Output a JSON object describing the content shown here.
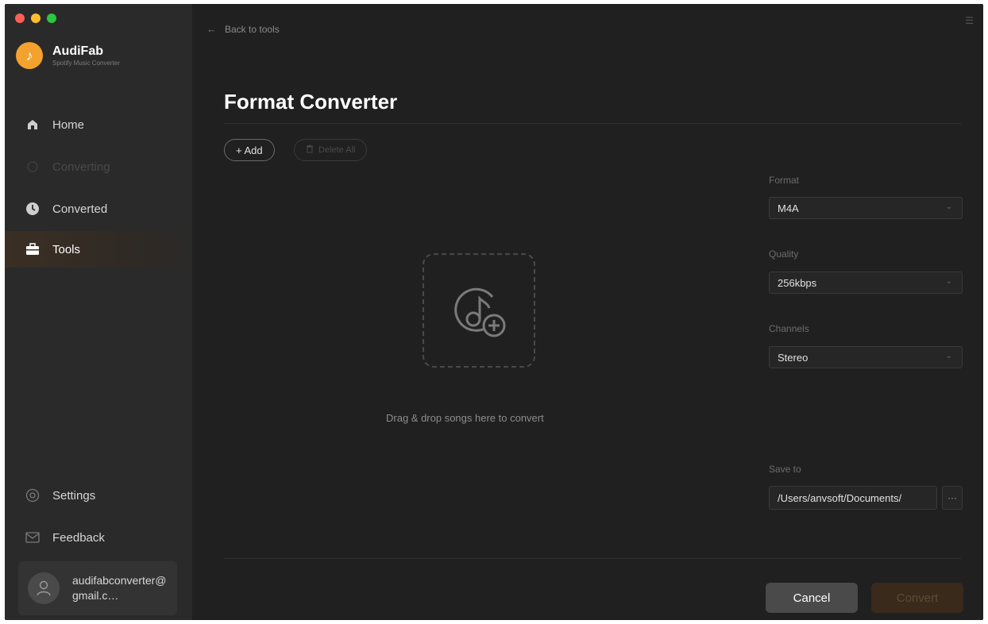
{
  "app": {
    "name": "AudiFab",
    "subtitle": "Spotify Music Converter"
  },
  "sidebar": {
    "items": [
      {
        "label": "Home",
        "icon": "home-icon",
        "state": "normal"
      },
      {
        "label": "Converting",
        "icon": "converting-icon",
        "state": "disabled"
      },
      {
        "label": "Converted",
        "icon": "clock-icon",
        "state": "normal"
      },
      {
        "label": "Tools",
        "icon": "toolbox-icon",
        "state": "active"
      }
    ],
    "bottom_items": [
      {
        "label": "Settings",
        "icon": "gear-icon"
      },
      {
        "label": "Feedback",
        "icon": "mail-icon"
      }
    ],
    "user": {
      "email": "audifabconverter@gmail.c…"
    }
  },
  "header": {
    "back_label": "Back to tools"
  },
  "main": {
    "title": "Format Converter",
    "add_label": "+ Add",
    "delete_all_label": "Delete All",
    "drop_text": "Drag & drop songs here to convert"
  },
  "settings": {
    "format_label": "Format",
    "format_value": "M4A",
    "quality_label": "Quality",
    "quality_value": "256kbps",
    "channels_label": "Channels",
    "channels_value": "Stereo",
    "save_to_label": "Save to",
    "save_to_value": "/Users/anvsoft/Documents/",
    "more_label": "···"
  },
  "footer": {
    "cancel_label": "Cancel",
    "convert_label": "Convert"
  },
  "colors": {
    "accent": "#f3a22e",
    "sidebar_bg": "#2a2a2a",
    "main_bg": "#202020"
  }
}
